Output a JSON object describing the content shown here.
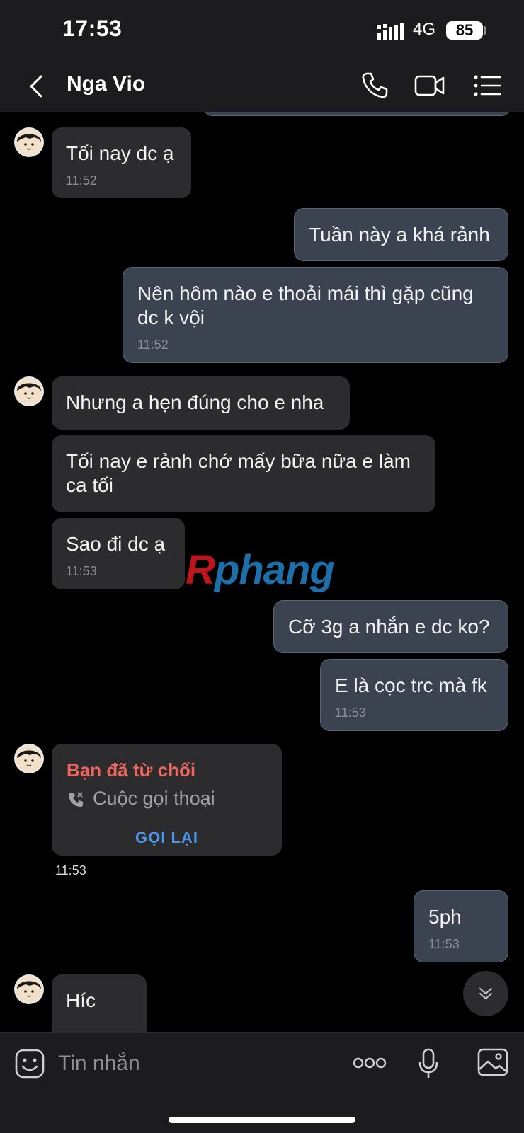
{
  "status_bar": {
    "time": "17:53",
    "network": "4G",
    "battery": "85"
  },
  "header": {
    "contact_name": "Nga Vio"
  },
  "messages": [
    {
      "dir": "in",
      "text": "Tối nay dc ạ",
      "time": "11:52"
    },
    {
      "dir": "out",
      "text": "Tuần này a khá rảnh"
    },
    {
      "dir": "out",
      "text": "Nên hôm nào e thoải mái thì gặp cũng dc k vội",
      "time": "11:52"
    },
    {
      "dir": "in",
      "text": "Nhưng a hẹn đúng cho e nha"
    },
    {
      "dir": "in",
      "text": "Tối nay e rảnh chớ mấy bữa nữa e làm ca tối"
    },
    {
      "dir": "in",
      "text": "Sao đi dc ạ",
      "time": "11:53"
    },
    {
      "dir": "out",
      "text": "Cỡ 3g a nhắn e dc ko?"
    },
    {
      "dir": "out",
      "text": "E là cọc trc mà fk",
      "time": "11:53"
    },
    {
      "dir": "out",
      "text": "5ph",
      "time": "11:53"
    },
    {
      "dir": "in",
      "text": "Híc"
    }
  ],
  "call_event": {
    "title": "Bạn đã từ chối",
    "type": "Cuộc gọi thoại",
    "action": "GỌI LẠI",
    "time": "11:53"
  },
  "watermark": {
    "first": "R",
    "rest": "phang"
  },
  "composer": {
    "placeholder": "Tin nhắn"
  },
  "icons": {
    "back": "chevron-left-icon",
    "call": "phone-icon",
    "video": "video-camera-icon",
    "menu": "list-menu-icon",
    "sticker": "sticker-face-icon",
    "more": "more-dots-icon",
    "mic": "microphone-icon",
    "image": "image-icon",
    "scroll": "double-chevron-down-icon"
  },
  "colors": {
    "outgoing_bubble": "#3b4350",
    "incoming_bubble": "#2c2c2e",
    "declined": "#f0665c",
    "call_back": "#4f94e8"
  }
}
